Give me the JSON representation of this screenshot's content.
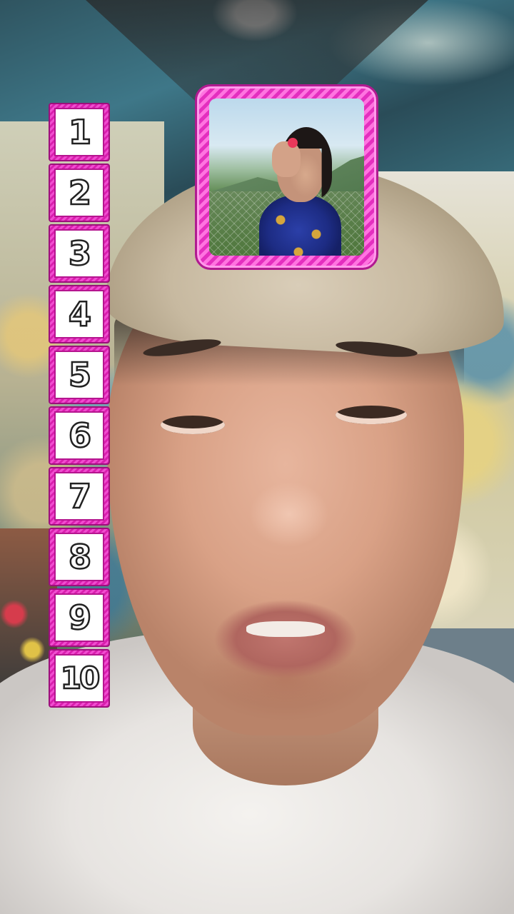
{
  "filter": {
    "numbers": [
      "1",
      "2",
      "3",
      "4",
      "5",
      "6",
      "7",
      "8",
      "9",
      "10"
    ]
  },
  "colors": {
    "frame_pink": "#e42fbf",
    "frame_dark": "#b01a90",
    "slot_fill": "#ffffff",
    "digit_outline": "#222222"
  },
  "current_pick": {
    "icon": "photo-card-icon"
  }
}
